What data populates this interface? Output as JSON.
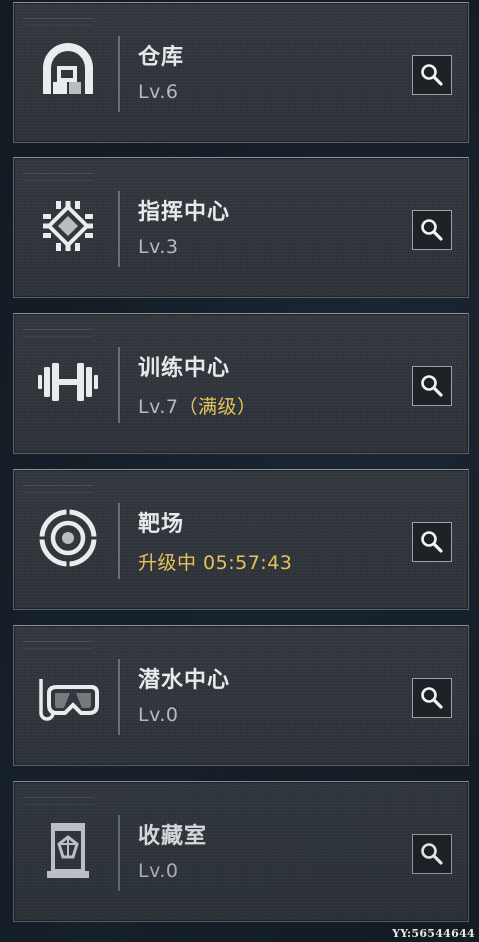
{
  "facilities": [
    {
      "name": "仓库",
      "level": "Lv.6",
      "level_suffix": "",
      "icon": "warehouse-icon"
    },
    {
      "name": "指挥中心",
      "level": "Lv.3",
      "level_suffix": "",
      "icon": "command-center-icon"
    },
    {
      "name": "训练中心",
      "level": "Lv.7",
      "level_suffix": "（满级）",
      "icon": "dumbbell-icon"
    },
    {
      "name": "靶场",
      "level": "升级中 05:57:43",
      "level_suffix": "",
      "icon": "target-icon",
      "upgrading": true
    },
    {
      "name": "潜水中心",
      "level": "Lv.0",
      "level_suffix": "",
      "icon": "diving-mask-icon"
    },
    {
      "name": "收藏室",
      "level": "Lv.0",
      "level_suffix": "",
      "icon": "display-case-icon"
    }
  ],
  "colors": {
    "card_bg": "#2e3439",
    "title": "#e6e8ea",
    "level": "#b5babf",
    "highlight": "#e7c25a"
  },
  "watermark": "YY:56544644"
}
